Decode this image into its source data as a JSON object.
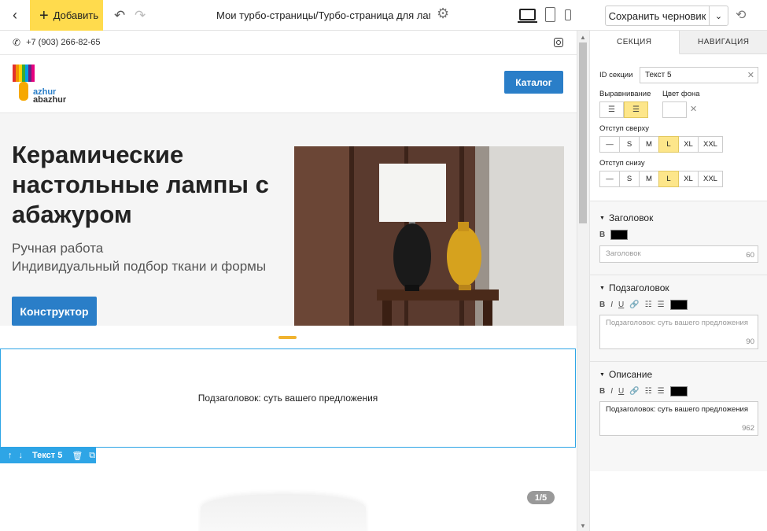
{
  "topbar": {
    "add_label": "Добавить",
    "breadcrumb": "Мои турбо-страницы/Турбо-страница для ламп",
    "save_label": "Сохранить черновик"
  },
  "site": {
    "phone": "+7 (903) 266-82-65",
    "logo_line1": "azhur",
    "logo_line2": "abazhur",
    "catalog_label": "Каталог",
    "hero_title": "Керамические настольные лампы с абажуром",
    "hero_sub_line1": "Ручная работа",
    "hero_sub_line2": "Индивидуальный подбор ткани и формы",
    "hero_button": "Конструктор",
    "selected_text": "Подзаголовок: суть вашего предложения",
    "selected_label": "Текст 5",
    "slide_counter": "1/5"
  },
  "panel": {
    "tabs": [
      "СЕКЦИЯ",
      "НАВИГАЦИЯ"
    ],
    "id_label": "ID секции",
    "id_value": "Текст 5",
    "align_label": "Выравнивание",
    "bg_label": "Цвет фона",
    "top_label": "Отступ сверху",
    "bottom_label": "Отступ снизу",
    "sizes": [
      "—",
      "S",
      "M",
      "L",
      "XL",
      "XXL"
    ],
    "heading_title": "Заголовок",
    "heading_placeholder": "Заголовок",
    "heading_count": "60",
    "subheading_title": "Подзаголовок",
    "subheading_placeholder": "Подзаголовок: суть вашего предложения",
    "subheading_count": "90",
    "desc_title": "Описание",
    "desc_value": "Подзаголовок: суть вашего предложения",
    "desc_count": "962"
  },
  "colors": {
    "accent_yellow": "#ffdb4d",
    "brand_blue": "#2a7ec8",
    "selection_blue": "#2ea5e6",
    "toggle_on": "#fde68a"
  }
}
